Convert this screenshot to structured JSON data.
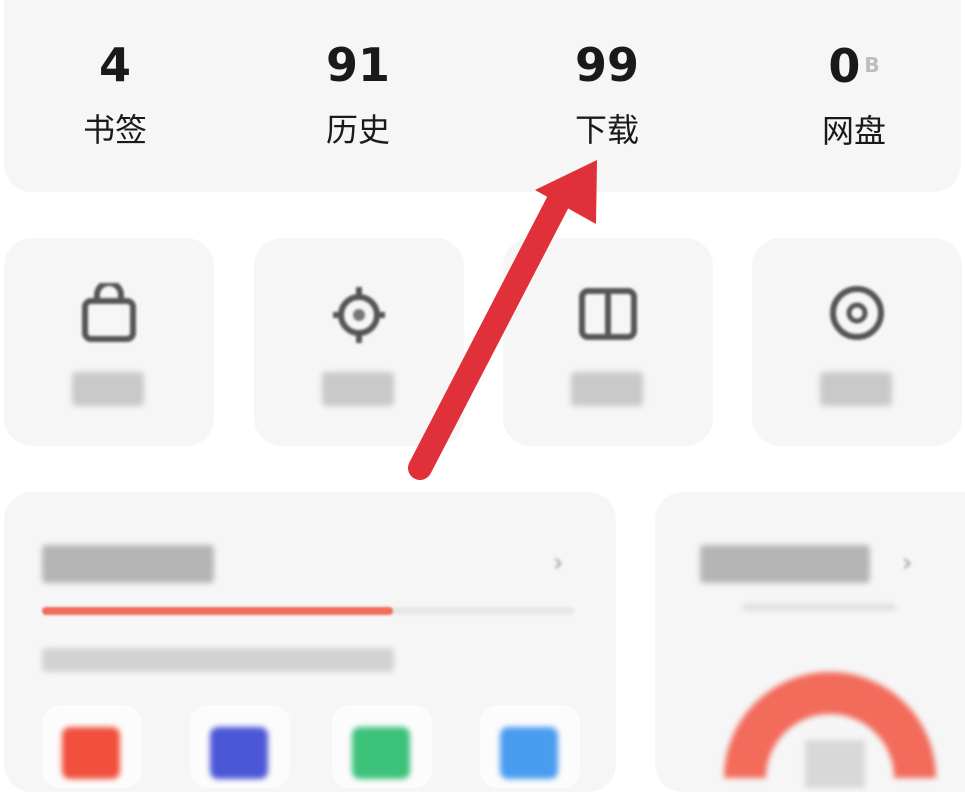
{
  "stats": [
    {
      "value": "4",
      "label": "书签",
      "unit": ""
    },
    {
      "value": "91",
      "label": "历史",
      "unit": ""
    },
    {
      "value": "99",
      "label": "下载",
      "unit": ""
    },
    {
      "value": "0",
      "label": "网盘",
      "unit": "B"
    }
  ],
  "tiles": [
    {
      "icon": "bag-icon"
    },
    {
      "icon": "settings-gear-icon"
    },
    {
      "icon": "book-icon"
    },
    {
      "icon": "compass-icon"
    }
  ],
  "storage_card": {
    "progress_percent": 66,
    "progress_color": "#f26b5b",
    "app_icons": [
      {
        "color": "#f0503c"
      },
      {
        "color": "#4b57d6"
      },
      {
        "color": "#3cc27a"
      },
      {
        "color": "#4a9cf0"
      }
    ]
  },
  "gauge_card": {
    "gauge_color": "#f26b5b"
  },
  "annotation": {
    "arrow_color": "#e0303a"
  }
}
